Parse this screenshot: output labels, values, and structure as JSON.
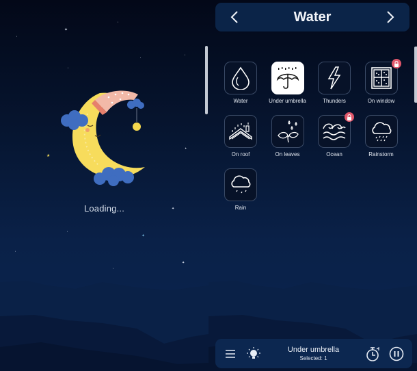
{
  "loading_screen": {
    "loading_text": "Loading..."
  },
  "header": {
    "title": "Water",
    "prev_icon": "chevron-left-icon",
    "next_icon": "chevron-right-icon"
  },
  "sounds": [
    {
      "label": "Water",
      "icon": "water-drop-icon",
      "selected": false,
      "locked": false
    },
    {
      "label": "Under umbrella",
      "icon": "umbrella-rain-icon",
      "selected": true,
      "locked": false
    },
    {
      "label": "Thunders",
      "icon": "lightning-icon",
      "selected": false,
      "locked": false
    },
    {
      "label": "On window",
      "icon": "window-rain-icon",
      "selected": false,
      "locked": true
    },
    {
      "label": "On roof",
      "icon": "roof-rain-icon",
      "selected": false,
      "locked": false
    },
    {
      "label": "On leaves",
      "icon": "leaves-rain-icon",
      "selected": false,
      "locked": false
    },
    {
      "label": "Ocean",
      "icon": "ocean-waves-icon",
      "selected": false,
      "locked": true
    },
    {
      "label": "Rainstorm",
      "icon": "rainstorm-cloud-icon",
      "selected": false,
      "locked": false
    },
    {
      "label": "Rain",
      "icon": "rain-cloud-icon",
      "selected": false,
      "locked": false
    }
  ],
  "player": {
    "title": "Under umbrella",
    "subtitle": "Selected: 1",
    "menu_icon": "menu-icon",
    "light_icon": "lightbulb-icon",
    "timer_icon": "timer-icon",
    "pause_icon": "pause-icon"
  },
  "colors": {
    "background_top": "#030818",
    "background_bottom": "#0b2550",
    "panel": "#0b2448",
    "lock_badge": "#e0576b",
    "moon": "#f7dc5c",
    "cloud": "#3f6dc0",
    "nightcap": "#f2b9a8"
  }
}
